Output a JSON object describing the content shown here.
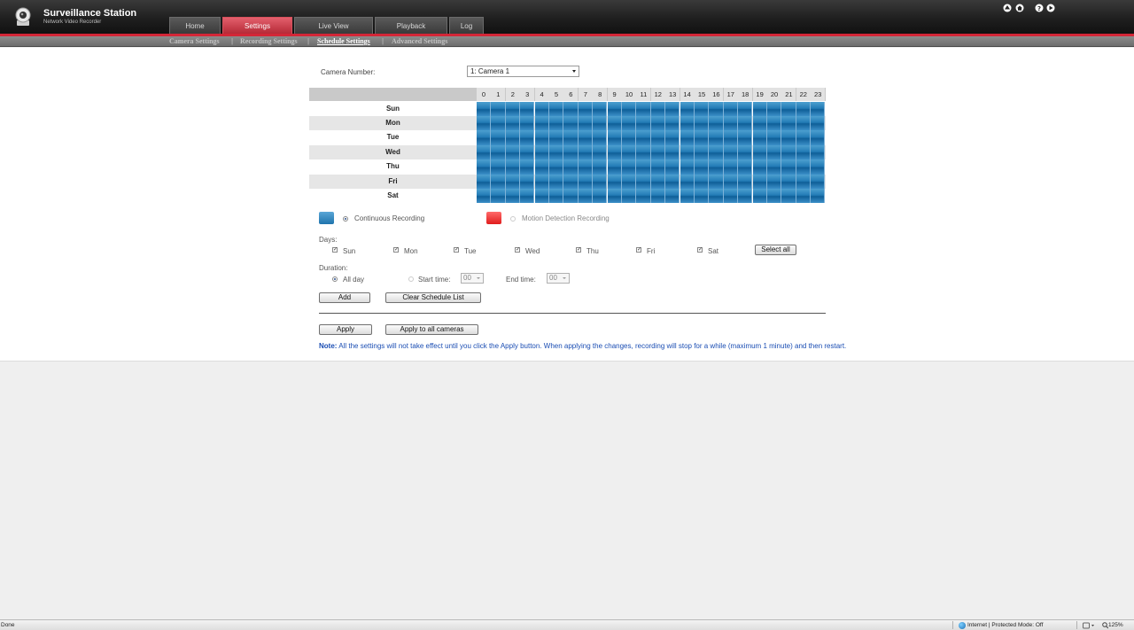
{
  "app": {
    "title": "Surveillance Station",
    "subtitle": "Network Video Recorder"
  },
  "tabs": [
    {
      "label": "Home",
      "active": false
    },
    {
      "label": "Settings",
      "active": true
    },
    {
      "label": "Live View",
      "active": false
    },
    {
      "label": "Playback",
      "active": false
    },
    {
      "label": "Log",
      "active": false
    }
  ],
  "subnav": [
    {
      "label": "Camera Settings",
      "active": false
    },
    {
      "label": "Recording Settings",
      "active": false
    },
    {
      "label": "Schedule Settings",
      "active": true
    },
    {
      "label": "Advanced Settings",
      "active": false
    }
  ],
  "camera": {
    "label": "Camera Number:",
    "selected": "1: Camera 1"
  },
  "schedule": {
    "hours": [
      "0",
      "1",
      "2",
      "3",
      "4",
      "5",
      "6",
      "7",
      "8",
      "9",
      "10",
      "11",
      "12",
      "13",
      "14",
      "15",
      "16",
      "17",
      "18",
      "19",
      "20",
      "21",
      "22",
      "23"
    ],
    "days": [
      "Sun",
      "Mon",
      "Tue",
      "Wed",
      "Thu",
      "Fri",
      "Sat"
    ],
    "mode": "continuous"
  },
  "legend": {
    "continuous": "Continuous Recording",
    "motion": "Motion Detection Recording",
    "continuous_color": "#237cb6",
    "motion_color": "#e8262f"
  },
  "days_form": {
    "label": "Days:",
    "items": [
      {
        "label": "Sun",
        "checked": true
      },
      {
        "label": "Mon",
        "checked": true
      },
      {
        "label": "Tue",
        "checked": true
      },
      {
        "label": "Wed",
        "checked": true
      },
      {
        "label": "Thu",
        "checked": true
      },
      {
        "label": "Fri",
        "checked": true
      },
      {
        "label": "Sat",
        "checked": true
      }
    ],
    "select_all": "Select all",
    "check_mark": "✓"
  },
  "duration": {
    "label": "Duration:",
    "all_day": "All day",
    "start_label": "Start time:",
    "start_value": "00",
    "end_label": "End time:",
    "end_value": "00"
  },
  "buttons": {
    "add": "Add",
    "clear": "Clear Schedule List",
    "apply": "Apply",
    "apply_all": "Apply to all cameras"
  },
  "note": {
    "prefix": "Note:",
    "text": " All the settings will not take effect until you click the Apply button. When applying the changes, recording will stop for a while (maximum 1 minute) and then restart."
  },
  "statusbar": {
    "left": "Done",
    "zone": "Internet | Protected Mode: Off",
    "zoom": "125%"
  },
  "colors": {
    "accent": "#d32637",
    "header": "#1f1f1f"
  },
  "icons": {
    "top": [
      "up-arrow-icon",
      "home-icon",
      "help-icon",
      "logout-icon"
    ]
  }
}
